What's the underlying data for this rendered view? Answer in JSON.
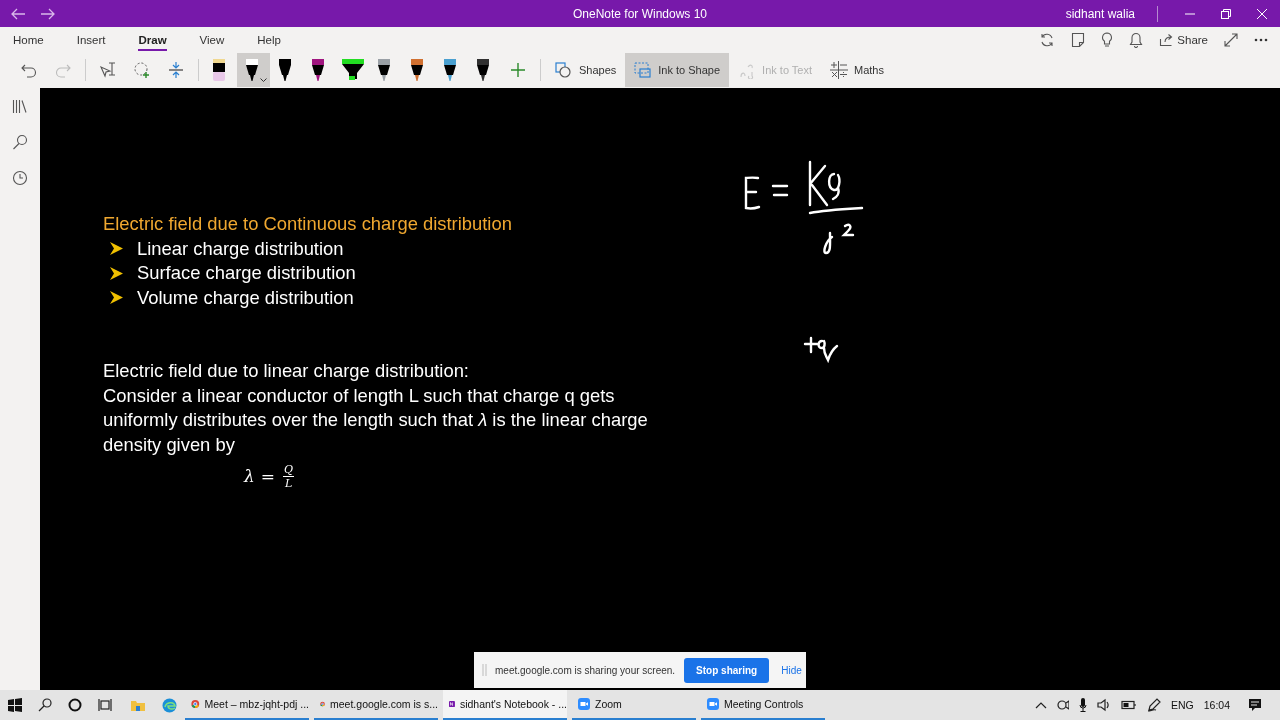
{
  "window": {
    "title": "OneNote for Windows 10",
    "user": "sidhant walia"
  },
  "tabs": [
    {
      "label": "Home",
      "selected": false
    },
    {
      "label": "Insert",
      "selected": false
    },
    {
      "label": "Draw",
      "selected": true
    },
    {
      "label": "View",
      "selected": false
    },
    {
      "label": "Help",
      "selected": false
    }
  ],
  "ribbon_actions": {
    "share": "Share"
  },
  "pens": [
    {
      "kind": "eraser",
      "color": "#e8c8e8",
      "selected": false
    },
    {
      "kind": "pen",
      "color": "#ffffff",
      "selected": true
    },
    {
      "kind": "pen",
      "color": "#000000",
      "selected": false
    },
    {
      "kind": "pen",
      "color": "#a0157f",
      "selected": false
    },
    {
      "kind": "highlighter",
      "color": "#22dd22",
      "selected": false
    },
    {
      "kind": "pen",
      "color": "#9aa0a6",
      "selected": false
    },
    {
      "kind": "pen",
      "color": "#d07030",
      "selected": false
    },
    {
      "kind": "pen",
      "color": "#4aa0d0",
      "selected": false
    },
    {
      "kind": "pen",
      "color": "#303030",
      "selected": false
    }
  ],
  "tools": [
    {
      "kind": "shapes",
      "label": "Shapes",
      "selected": false,
      "disabled": false
    },
    {
      "kind": "ink-to-shape",
      "label": "Ink to Shape",
      "selected": true,
      "disabled": false
    },
    {
      "kind": "ink-to-text",
      "label": "Ink to Text",
      "selected": false,
      "disabled": true
    },
    {
      "kind": "maths",
      "label": "Maths",
      "selected": false,
      "disabled": false
    }
  ],
  "note": {
    "heading": "Electric field due to Continuous charge distribution",
    "bullets": [
      "Linear charge distribution",
      "Surface charge distribution",
      "Volume charge distribution"
    ],
    "subheading": "Electric field due to linear charge distribution:",
    "paragraph": "Consider a linear conductor of length L such that charge q gets uniformly distributes over the length such that *λ* is the linear charge density given by",
    "formula": {
      "lhs": "λ",
      "equals": "=",
      "numerator": "Q",
      "denominator": "L"
    }
  },
  "sharing_bar": {
    "message": "meet.google.com is sharing your screen.",
    "stop": "Stop sharing",
    "hide": "Hide"
  },
  "taskbar": {
    "apps": [
      {
        "kind": "chrome",
        "label": "Meet – mbz-jqht-pdj ...",
        "selected": false
      },
      {
        "kind": "chrome",
        "label": "meet.google.com is s...",
        "selected": false
      },
      {
        "kind": "onenote",
        "label": "sidhant's Notebook - ...",
        "selected": true
      },
      {
        "kind": "zoom",
        "label": "Zoom",
        "selected": false
      },
      {
        "kind": "zoom",
        "label": "Meeting Controls",
        "selected": false
      }
    ],
    "language": "ENG",
    "time": "16:04"
  }
}
